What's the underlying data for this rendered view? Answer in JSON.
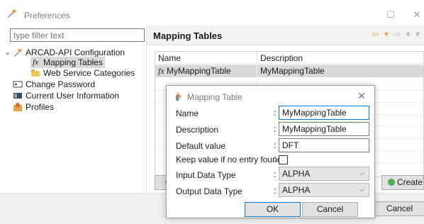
{
  "window": {
    "title": "Preferences",
    "minimize_glyph": "☐",
    "close_glyph": "✕"
  },
  "filter": {
    "placeholder": "type filter text"
  },
  "tree": {
    "items": [
      {
        "label": "ARCAD-API Configuration",
        "icon": "wrench-icon",
        "expander": "⌄"
      },
      {
        "label": "Mapping Tables",
        "icon": "function-icon",
        "glyph": "fx"
      },
      {
        "label": "Web Service Categories",
        "icon": "folder-icon"
      },
      {
        "label": "Change Password",
        "icon": "password-icon"
      },
      {
        "label": "Current User Information",
        "icon": "user-card-icon"
      },
      {
        "label": "Profiles",
        "icon": "profiles-icon"
      }
    ]
  },
  "page": {
    "title": "Mapping Tables",
    "nav": {
      "back": "⇦ ▾",
      "forward": "⇨ ▾ ▾"
    }
  },
  "table": {
    "columns": [
      "Name",
      "Description"
    ],
    "rows": [
      {
        "name": "MyMappingTable",
        "description": "MyMappingTable",
        "glyph": "fx"
      }
    ]
  },
  "buttons": {
    "create": "Create",
    "cancel": "Cancel"
  },
  "dialog": {
    "title": "Mapping Table",
    "close": "✕",
    "fields": {
      "name_label": "Name",
      "name_value": "MyMappingTable",
      "description_label": "Description",
      "description_value": "MyMappingTable",
      "default_label": "Default value",
      "default_value": "DFT",
      "keep_label": "Keep value if no entry found",
      "keep_checked": false,
      "input_type_label": "Input Data Type",
      "input_type_value": "ALPHA",
      "output_type_label": "Output Data Type",
      "output_type_value": "ALPHA",
      "colon": ":"
    },
    "ok": "OK",
    "cancel": "Cancel"
  },
  "colors": {
    "accent": "#0078d7",
    "selection": "#d9d9d9",
    "nav_arrow": "#e5a93c"
  }
}
